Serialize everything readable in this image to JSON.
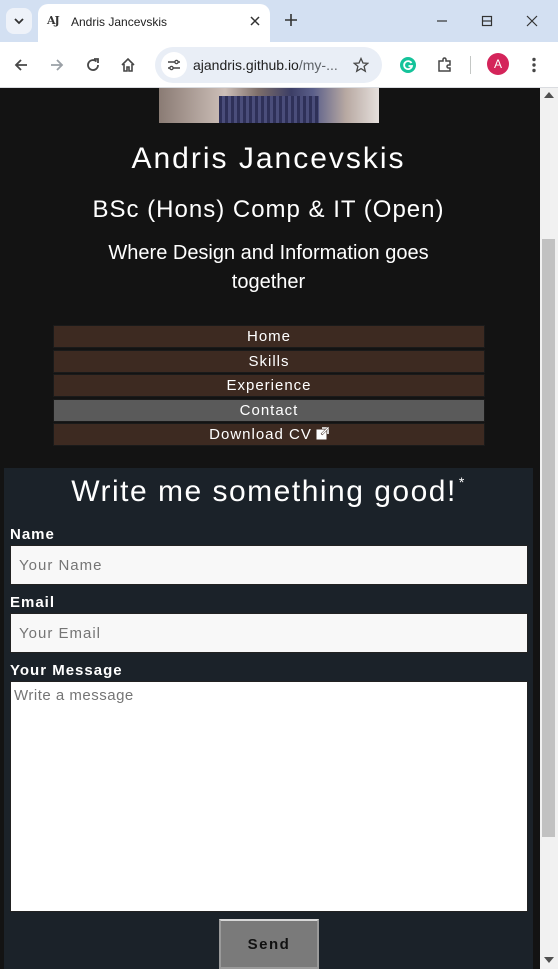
{
  "browser": {
    "tab": {
      "favicon_text": "AJ",
      "title": "Andris Jancevskis"
    },
    "url_host": "ajandris.github.io",
    "url_rest": "/my-...",
    "profile_initial": "A"
  },
  "profile": {
    "name": "Andris Jancevskis",
    "degree": "BSc (Hons) Comp & IT (Open)",
    "tagline": "Where Design and Information goes together"
  },
  "nav": {
    "items": [
      {
        "label": "Home"
      },
      {
        "label": "Skills"
      },
      {
        "label": "Experience"
      },
      {
        "label": "Contact",
        "active": true
      },
      {
        "label": "Download CV"
      }
    ]
  },
  "contact": {
    "title": "Write me something good!",
    "title_mark": "*",
    "name_label": "Name",
    "name_placeholder": "Your Name",
    "email_label": "Email",
    "email_placeholder": "Your Email",
    "message_label": "Your Message",
    "message_placeholder": "Write a message",
    "send_label": "Send"
  },
  "colors": {
    "page_bg": "#131313",
    "nav_bg": "#3d2a21",
    "nav_active_bg": "#5a5a5a",
    "form_bg": "#1b2229",
    "send_bg": "#7a7a7a"
  }
}
